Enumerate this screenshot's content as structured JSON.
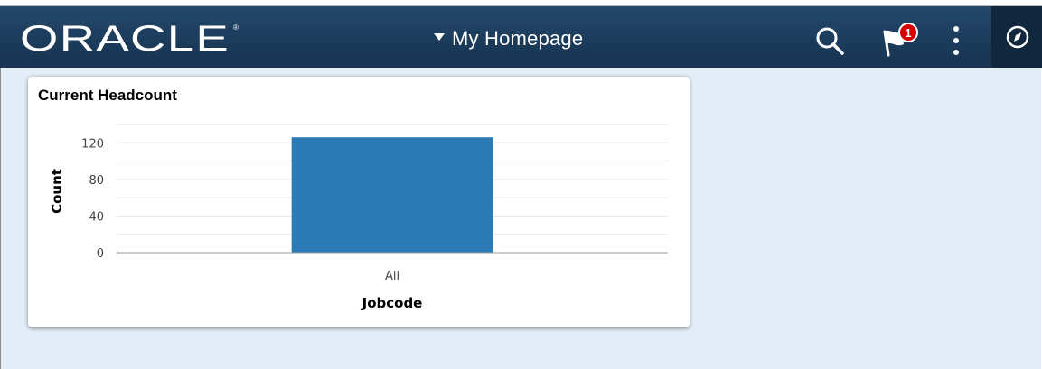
{
  "header": {
    "logo_text": "ORACLE",
    "page_title": "My Homepage",
    "notification_count": "1",
    "icons": [
      "search-icon",
      "flag-icon",
      "more-vertical-icon",
      "navbar-compass-icon"
    ],
    "colors": {
      "banner": "#1f4263",
      "bar": "#2a7ab5",
      "badge": "#d50000"
    }
  },
  "tile": {
    "title": "Current Headcount"
  },
  "chart_data": {
    "type": "bar",
    "title": "Current Headcount",
    "categories": [
      "All"
    ],
    "values": [
      126
    ],
    "xlabel": "Jobcode",
    "ylabel": "Count",
    "yticks": [
      0,
      40,
      80,
      120
    ],
    "ylim": [
      0,
      140
    ],
    "grid": true,
    "legend": "none"
  }
}
